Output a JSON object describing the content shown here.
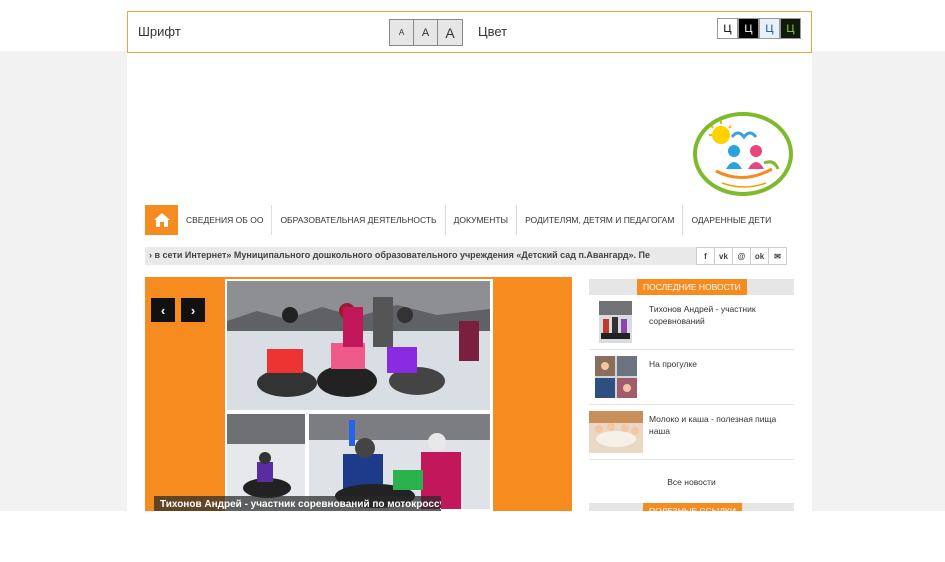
{
  "accessibility": {
    "font_label": "Шрифт",
    "font_sizes": [
      "A",
      "A",
      "A"
    ],
    "color_label": "Цвет",
    "color_options": [
      {
        "label": "Ц",
        "bg": "#ffffff",
        "fg": "#000000"
      },
      {
        "label": "Ц",
        "bg": "#000000",
        "fg": "#ffffff"
      },
      {
        "label": "Ц",
        "bg": "#e8f1fb",
        "fg": "#1b4f8c"
      },
      {
        "label": "Ц",
        "bg": "#0f1a08",
        "fg": "#9acd32"
      }
    ]
  },
  "nav": {
    "home_icon": "home-icon",
    "items": [
      "СВЕДЕНИЯ ОБ ОО",
      "ОБРАЗОВАТЕЛЬНАЯ ДЕЯТЕЛЬНОСТЬ",
      "ДОКУМЕНТЫ",
      "РОДИТЕЛЯМ, ДЕТЯМ И ПЕДАГОГАМ",
      "ОДАРЕННЫЕ ДЕТИ"
    ]
  },
  "ticker": {
    "text": "› в сети Интернет» Муниципального дошкольного образовательного учреждения «Детский сад п.Авангард». Пе"
  },
  "social": [
    "f",
    "vk",
    "ok-mail",
    "ok",
    "mail"
  ],
  "slider": {
    "caption": "Тихонов Андрей - участник соревнований по мотокроссу",
    "prev": "‹",
    "next": "›"
  },
  "news": {
    "heading": "ПОСЛЕДНИЕ НОВОСТИ",
    "items": [
      {
        "title": "Тихонов Андрей - участник соревнований"
      },
      {
        "title": "На прогулке"
      },
      {
        "title": "Молоко и каша - полезная пища наша"
      }
    ],
    "all_link": "Все новости"
  },
  "links": {
    "heading": "ПОЛЕЗНЫЕ ССЫЛКИ"
  },
  "colors": {
    "accent": "#f68b1f"
  }
}
